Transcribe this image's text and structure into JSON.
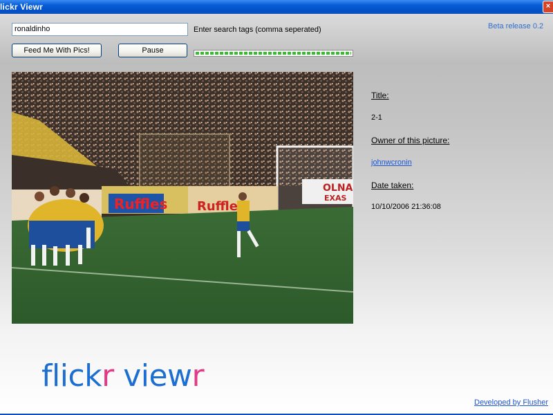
{
  "window": {
    "title": "lickr Viewr",
    "close_glyph": "×"
  },
  "search": {
    "value": "ronaldinho",
    "hint": "Enter search tags (comma seperated)"
  },
  "version": "Beta release 0.2",
  "buttons": {
    "feed": "Feed Me With Pics!",
    "pause": "Pause"
  },
  "progress": {
    "value": 1.0,
    "color": "#32c02a"
  },
  "photo_signs": [
    "Ruffles",
    "Ruffles",
    "OLNA",
    "EXAS"
  ],
  "info": {
    "title_label": "Title:",
    "title_value": "2-1",
    "owner_label": "Owner of this picture:",
    "owner_value": "johnwcronin",
    "date_label": "Date taken:",
    "date_value": "10/10/2006 21:36:08"
  },
  "logo": {
    "part1": "flick",
    "part2": "r",
    "part3": " view",
    "part4": "r"
  },
  "credit": "Developed by Flusher",
  "colors": {
    "title_bar": "#0352c9",
    "link": "#1c55d6",
    "logo_blue": "#1c6fd0",
    "logo_pink": "#e23a86",
    "field": "#2f6f35"
  },
  "icons": {
    "close": "close-icon"
  }
}
